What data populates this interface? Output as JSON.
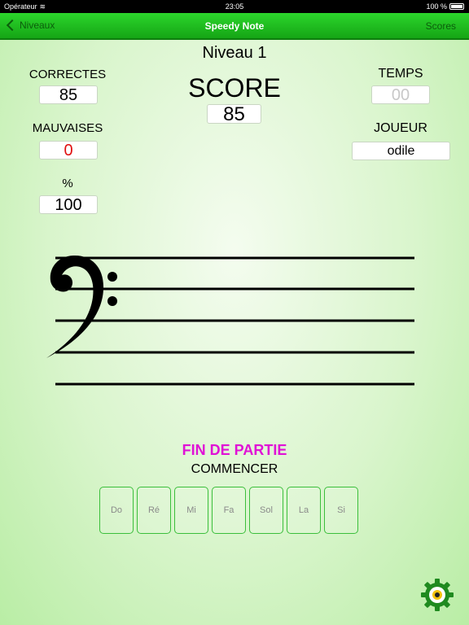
{
  "status_bar": {
    "carrier": "Opérateur",
    "time": "23:05",
    "battery": "100 %"
  },
  "nav": {
    "back_label": "Niveaux",
    "title": "Speedy Note",
    "right_label": "Scores"
  },
  "level_title": "Niveau 1",
  "stats": {
    "correctes_label": "CORRECTES",
    "correctes_value": "85",
    "mauvaises_label": "MAUVAISES",
    "mauvaises_value": "0",
    "percent_label": "%",
    "percent_value": "100",
    "score_label": "SCORE",
    "score_value": "85",
    "temps_label": "TEMPS",
    "temps_value": "00",
    "joueur_label": "JOUEUR",
    "joueur_value": "odile"
  },
  "game": {
    "status": "FIN DE PARTIE",
    "start_label": "COMMENCER"
  },
  "notes": [
    "Do",
    "Ré",
    "Mi",
    "Fa",
    "Sol",
    "La",
    "Si"
  ],
  "colors": {
    "nav_green": "#1fbe1f",
    "status_pink": "#e012d6",
    "error_red": "#e01010",
    "muted_grey": "#c8c8c8"
  },
  "icons": {
    "settings": "gear-icon",
    "back": "chevron-left-icon",
    "clef": "bass-clef-icon"
  }
}
